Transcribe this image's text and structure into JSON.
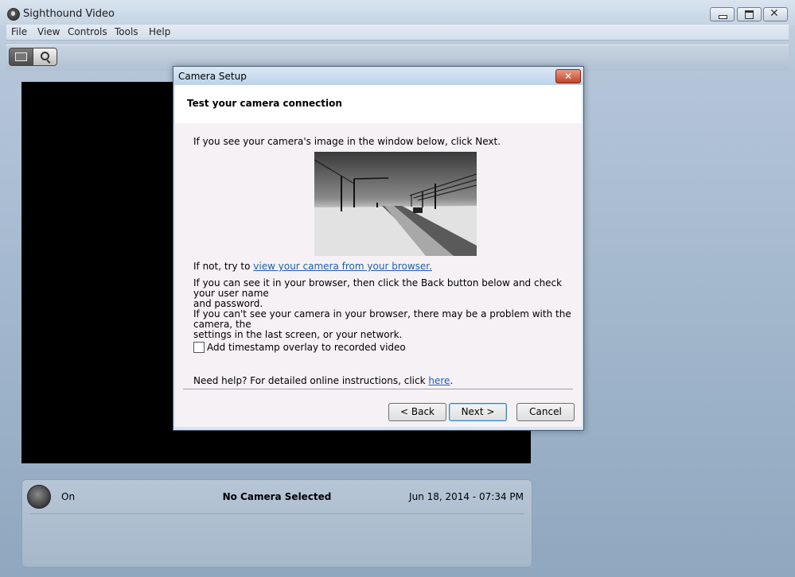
{
  "app": {
    "title": "Sighthound Video"
  },
  "menu": [
    "File",
    "View",
    "Controls",
    "Tools",
    "Help"
  ],
  "status": {
    "state": "On",
    "camera": "No Camera Selected",
    "datetime": "Jun 18, 2014 - 07:34 PM"
  },
  "dialog": {
    "title": "Camera Setup",
    "close": "✕",
    "heading": "Test your camera connection",
    "intro": "If you see your camera's image in the window below, click Next.",
    "ifnot_prefix": "If not, try to",
    "ifnot_link": "view your camera from your browser.",
    "browser_line1": "If you can see it in your browser, then click the Back button below and check your user name",
    "browser_line2": "and password.",
    "cant_line1": "If you can't see your camera in your browser, there may be a problem with the camera, the",
    "cant_line2": "settings in the last screen, or your network.",
    "checkbox_label": "Add timestamp overlay to recorded video",
    "checkbox_checked": false,
    "help_prefix": "Need help?  For detailed online instructions, click",
    "help_link": "here",
    "help_suffix": ".",
    "buttons": {
      "back": "< Back",
      "next": "Next >",
      "cancel": "Cancel"
    }
  }
}
